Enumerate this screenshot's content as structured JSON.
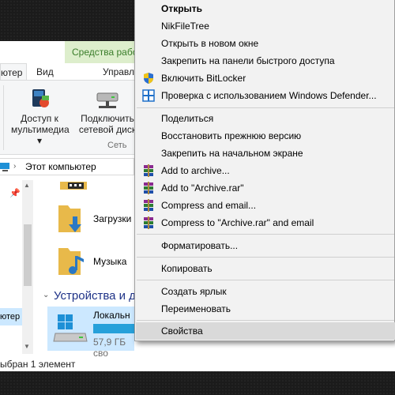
{
  "explorer": {
    "tools_tab": "Средства рабо",
    "tabs": [
      "ютер",
      "Вид",
      "Управл"
    ],
    "ribbon": {
      "media_button": [
        "Доступ к",
        "мультимедиа"
      ],
      "drive_button": [
        "Подключить",
        "сетевой диск"
      ],
      "network_group": "Сеть"
    },
    "address": "Этот компьютер",
    "nav_selected": "ютер",
    "content": {
      "downloads": "Загрузки",
      "music": "Музыка",
      "devices_header": "Устройства и д",
      "local_drive": "Локальн",
      "drive_free": "57,9 ГБ сво"
    },
    "status": "ыбран 1 элемент"
  },
  "context_menu": {
    "items": [
      {
        "label": "Открыть",
        "bold": true,
        "icon": "none"
      },
      {
        "label": "NikFileTree",
        "icon": "none"
      },
      {
        "label": "Открыть в новом окне",
        "icon": "none"
      },
      {
        "label": "Закрепить на панели быстрого доступа",
        "icon": "none"
      },
      {
        "label": "Включить BitLocker",
        "icon": "uac-shield-icon"
      },
      {
        "label": "Проверка с использованием Windows Defender...",
        "icon": "defender-icon"
      },
      {
        "label": "Поделиться",
        "icon": "none"
      },
      {
        "label": "Восстановить прежнюю версию",
        "icon": "none"
      },
      {
        "label": "Закрепить на начальном экране",
        "icon": "none"
      },
      {
        "label": "Add to archive...",
        "icon": "winrar-icon"
      },
      {
        "label": "Add to \"Archive.rar\"",
        "icon": "winrar-icon"
      },
      {
        "label": "Compress and email...",
        "icon": "winrar-icon"
      },
      {
        "label": "Compress to \"Archive.rar\" and email",
        "icon": "winrar-icon"
      },
      {
        "label": "Форматировать...",
        "icon": "none"
      },
      {
        "label": "Копировать",
        "icon": "none"
      },
      {
        "label": "Создать ярлык",
        "icon": "none"
      },
      {
        "label": "Переименовать",
        "icon": "none"
      },
      {
        "label": "Свойства",
        "icon": "none",
        "highlighted": true
      }
    ]
  },
  "colors": {
    "menu_bg": "#f2f2f2",
    "highlight": "#d9d9d9",
    "tools_tab_bg": "#ddeecc",
    "selection": "#cce8ff",
    "folder": "#e8b94a"
  }
}
